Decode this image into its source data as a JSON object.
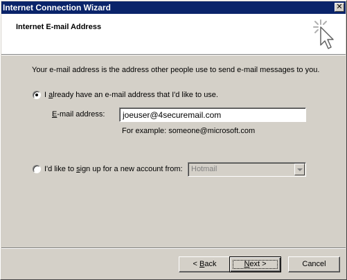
{
  "window": {
    "title": "Internet Connection Wizard",
    "close_glyph": "✕"
  },
  "header": {
    "title": "Internet E-mail Address",
    "icon": "wizard-cursor-icon"
  },
  "description": "Your e-mail address is the address other people use to send e-mail messages to you.",
  "option_existing": {
    "label_pre": "I ",
    "label_accel": "a",
    "label_post": "lready have an e-mail address that I'd like to use.",
    "selected": true
  },
  "email_field": {
    "label_accel": "E",
    "label_rest": "-mail address:",
    "value": "joeuser@4securemail.com",
    "example": "For example: someone@microsoft.com"
  },
  "option_new": {
    "label_pre": "I'd like to ",
    "label_accel": "s",
    "label_post": "ign up for a new account from:",
    "selected": false,
    "provider": "Hotmail"
  },
  "buttons": {
    "back_prefix": "< ",
    "back_accel": "B",
    "back_rest": "ack",
    "next_accel": "N",
    "next_rest": "ext >",
    "cancel": "Cancel"
  }
}
